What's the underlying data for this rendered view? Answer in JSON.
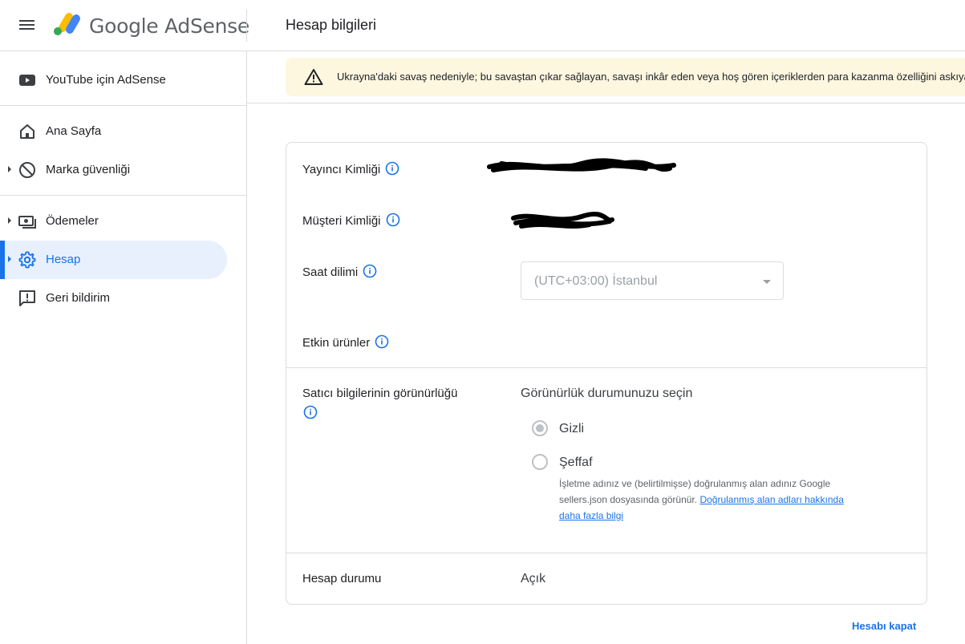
{
  "header": {
    "brand": "Google AdSense",
    "page_title": "Hesap bilgileri"
  },
  "sidebar": {
    "items": [
      {
        "label": "YouTube için AdSense",
        "icon": "youtube-icon"
      },
      {
        "label": "Ana Sayfa",
        "icon": "home-icon"
      },
      {
        "label": "Marka güvenliği",
        "icon": "block-icon"
      },
      {
        "label": "Ödemeler",
        "icon": "payments-icon"
      },
      {
        "label": "Hesap",
        "icon": "gear-icon",
        "active": true
      },
      {
        "label": "Geri bildirim",
        "icon": "feedback-icon"
      }
    ]
  },
  "banner": {
    "text": "Ukrayna'daki savaş nedeniyle; bu savaştan çıkar sağlayan, savaşı inkâr eden veya hoş gören içeriklerden para kazanma özelliğini askıya a"
  },
  "account": {
    "publisher_id_label": "Yayıncı Kimliği",
    "customer_id_label": "Müşteri Kimliği",
    "timezone_label": "Saat dilimi",
    "timezone_value": "(UTC+03:00) İstanbul",
    "active_products_label": "Etkin ürünler",
    "seller_visibility_label": "Satıcı bilgilerinin görünürlüğü",
    "visibility_prompt": "Görünürlük durumunuzu seçin",
    "option_hidden": "Gizli",
    "option_transparent": "Şeffaf",
    "transparent_desc": "İşletme adınız ve (belirtilmişse) doğrulanmış alan adınız Google sellers.json dosyasında görünür. ",
    "learn_more_link": "Doğrulanmış alan adları hakkında daha fazla bilgi",
    "status_label": "Hesap durumu",
    "status_value": "Açık"
  },
  "footer": {
    "close_account": "Hesabı kapat"
  },
  "colors": {
    "accent": "#1a73e8",
    "active_bg": "#e8f0fe",
    "banner_bg": "#fef7e0"
  }
}
